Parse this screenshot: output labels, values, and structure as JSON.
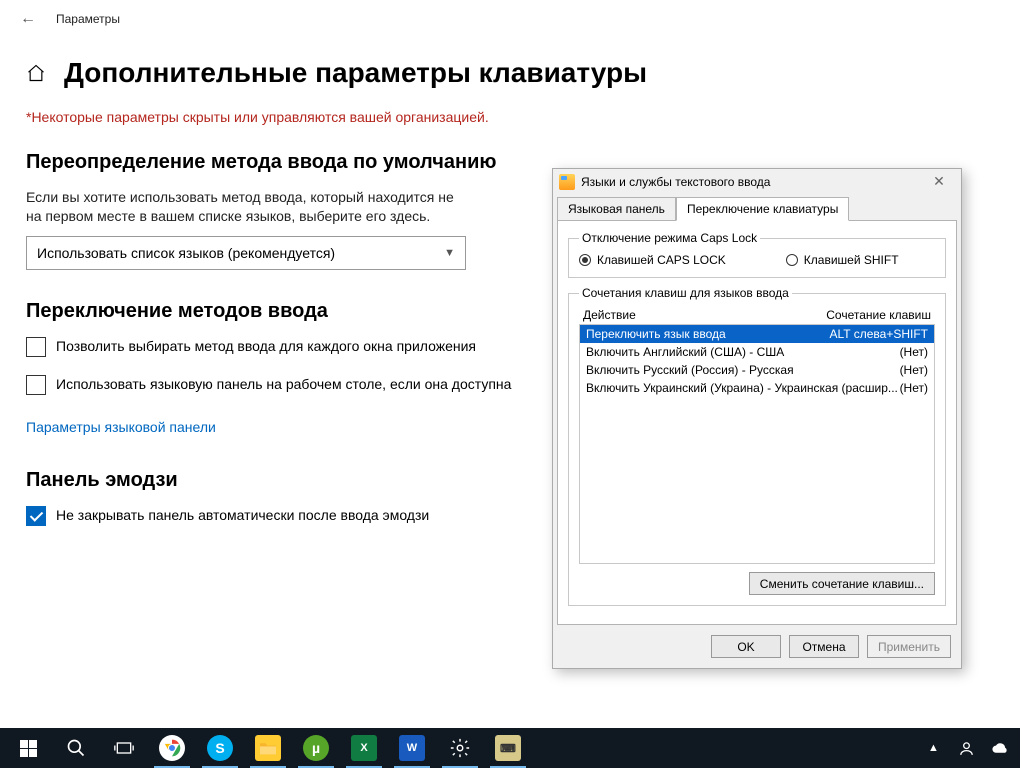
{
  "header": {
    "title": "Параметры"
  },
  "page": {
    "title": "Дополнительные параметры клавиатуры",
    "warning": "*Некоторые параметры скрыты или управляются вашей организацией.",
    "section_override": "Переопределение метода ввода по умолчанию",
    "override_desc": "Если вы хотите использовать метод ввода, который находится не на первом месте в вашем списке языков, выберите его здесь.",
    "select_value": "Использовать список языков (рекомендуется)",
    "section_switch": "Переключение методов ввода",
    "cb_per_window": "Позволить выбирать метод ввода для каждого окна приложения",
    "cb_langbar": "Использовать языковую панель на рабочем столе, если она доступна",
    "link_langbar": "Параметры языковой панели",
    "section_emoji": "Панель эмодзи",
    "cb_emoji": "Не закрывать панель автоматически после ввода эмодзи"
  },
  "dialog": {
    "title": "Языки и службы текстового ввода",
    "tabs": [
      "Языковая панель",
      "Переключение клавиатуры"
    ],
    "active_tab": 1,
    "capslock_legend": "Отключение режима Caps Lock",
    "radio_caps": "Клавишей CAPS LOCK",
    "radio_shift": "Клавишей SHIFT",
    "hotkeys_legend": "Сочетания клавиш для языков ввода",
    "col_action": "Действие",
    "col_combo": "Сочетание клавиш",
    "rows": [
      {
        "action": "Переключить язык ввода",
        "combo": "ALT слева+SHIFT",
        "sel": true
      },
      {
        "action": "Включить Английский (США) - США",
        "combo": "(Нет)",
        "sel": false
      },
      {
        "action": "Включить Русский (Россия) - Русская",
        "combo": "(Нет)",
        "sel": false
      },
      {
        "action": "Включить Украинский (Украина) - Украинская (расшир...",
        "combo": "(Нет)",
        "sel": false
      }
    ],
    "btn_change": "Сменить сочетание клавиш...",
    "btn_ok": "OK",
    "btn_cancel": "Отмена",
    "btn_apply": "Применить"
  }
}
